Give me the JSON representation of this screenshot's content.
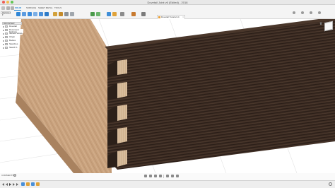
{
  "window": {
    "title": "Dovetail Joint v6 (Edited) - 2018"
  },
  "toolbar": {
    "workspace": "DESIGN ▾",
    "tabs": [
      {
        "label": "SOLID",
        "active": true
      },
      {
        "label": "SURFACE",
        "active": false
      },
      {
        "label": "SHEET METAL",
        "active": false
      },
      {
        "label": "TOOLS",
        "active": false
      }
    ],
    "groups": [
      {
        "label": "CREATE ▾"
      },
      {
        "label": "MODIFY ▾"
      },
      {
        "label": "ASSEMBLE ▾"
      },
      {
        "label": "CONSTRUCT ▾"
      },
      {
        "label": "INSPECT ▾"
      },
      {
        "label": "INSERT ▾"
      },
      {
        "label": "SELECT ▾"
      }
    ],
    "document_tab": "Dovetail Tutorial v4",
    "document_tab_close": "×"
  },
  "browser": {
    "header": "BROWSER",
    "items": [
      {
        "label": "Dovetail"
      },
      {
        "label": "Document Settings"
      },
      {
        "label": "Named Views"
      },
      {
        "label": "Origin"
      },
      {
        "label": "Bodies"
      },
      {
        "label": "Sketches"
      },
      {
        "label": "Sketch 1"
      }
    ]
  },
  "comments": {
    "label": "COMMENTS",
    "add": "+"
  },
  "colors": {
    "accent": "#1a7fd4",
    "light_wood": "#c9a27e",
    "dark_wood": "#3a2a21",
    "pin_wood": "#d7bc9c"
  },
  "icons": {
    "nav": [
      "orbit-icon",
      "pan-icon",
      "zoom-icon",
      "fit-icon",
      "display-settings-icon",
      "grid-icon",
      "viewports-icon"
    ],
    "timeline": [
      "go-to-start-icon",
      "previous-step-icon",
      "play-icon",
      "next-step-icon",
      "go-to-end-icon"
    ]
  }
}
